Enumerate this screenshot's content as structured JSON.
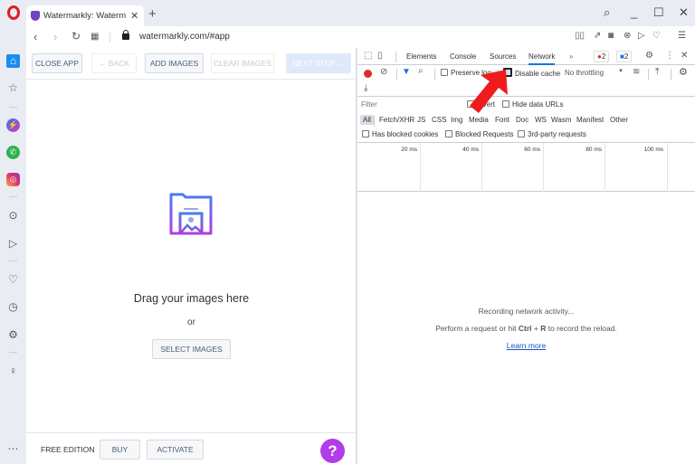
{
  "browser": {
    "tab_title": "Watermarkly: Watermark Photos",
    "url": "watermarkly.com/#app",
    "new_tab_label": "+",
    "tab_close": "✕"
  },
  "app": {
    "toolbar": {
      "close_app": "CLOSE APP",
      "back": "← BACK",
      "add_images": "ADD IMAGES",
      "clear_images": "CLEAR IMAGES",
      "next_step": "NEXT STEP →"
    },
    "drop": {
      "title": "Drag your images here",
      "or": "or",
      "select_images": "SELECT IMAGES"
    },
    "footer": {
      "edition": "FREE EDITION",
      "buy": "BUY",
      "activate": "ACTIVATE",
      "help": "?"
    }
  },
  "devtools": {
    "tabs": [
      "Elements",
      "Console",
      "Sources",
      "Network"
    ],
    "active_tab": "Network",
    "more_tabs": "»",
    "error_count": "2",
    "message_count": "2",
    "preserve_log": "Preserve log",
    "disable_cache": "Disable cache",
    "disable_cache_checked": true,
    "throttling": "No throttling",
    "filter_placeholder": "Filter",
    "invert": "Invert",
    "hide_data_urls": "Hide data URLs",
    "types": [
      "All",
      "Fetch/XHR",
      "JS",
      "CSS",
      "Img",
      "Media",
      "Font",
      "Doc",
      "WS",
      "Wasm",
      "Manifest",
      "Other"
    ],
    "active_type": "All",
    "has_blocked_cookies": "Has blocked cookies",
    "blocked_requests": "Blocked Requests",
    "third_party": "3rd-party requests",
    "timeline_labels": [
      "20 ms",
      "40 ms",
      "60 ms",
      "80 ms",
      "100 ms"
    ],
    "empty": {
      "recording": "Recording network activity...",
      "perform_pre": "Perform a request or hit ",
      "ctrl": "Ctrl",
      "plus": " + ",
      "r": "R",
      "perform_post": " to record the reload.",
      "learn_more": "Learn more"
    }
  }
}
